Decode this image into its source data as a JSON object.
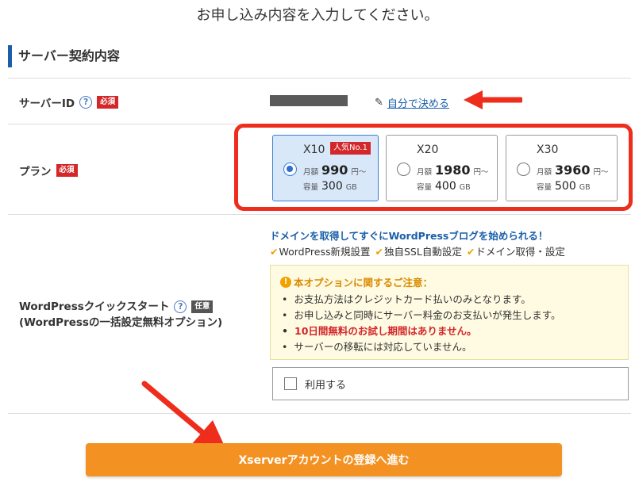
{
  "page": {
    "heading": "お申し込み内容を入力してください。"
  },
  "section": {
    "title": "サーバー契約内容"
  },
  "server_id": {
    "label": "サーバーID",
    "help_icon": "?",
    "required_badge": "必須",
    "self_link_label": "自分で決める"
  },
  "plan": {
    "label": "プラン",
    "required_badge": "必須",
    "options": [
      {
        "name": "X10",
        "popular_badge": "人気No.1",
        "price_label": "月額",
        "price": "990",
        "price_unit": "円〜",
        "storage_label": "容量",
        "storage": "300",
        "storage_unit": "GB",
        "selected": true
      },
      {
        "name": "X20",
        "popular_badge": "",
        "price_label": "月額",
        "price": "1980",
        "price_unit": "円〜",
        "storage_label": "容量",
        "storage": "400",
        "storage_unit": "GB",
        "selected": false
      },
      {
        "name": "X30",
        "popular_badge": "",
        "price_label": "月額",
        "price": "3960",
        "price_unit": "円〜",
        "storage_label": "容量",
        "storage": "500",
        "storage_unit": "GB",
        "selected": false
      }
    ]
  },
  "wp_quickstart": {
    "label_line1": "WordPressクイックスタート",
    "label_line2": "(WordPressの一括設定無料オプション)",
    "help_icon": "?",
    "optional_badge": "任意",
    "promo": "ドメインを取得してすぐにWordPressブログを始められる！",
    "features": [
      "WordPress新規設置",
      "独自SSL自動設定",
      "ドメイン取得・設定"
    ],
    "feature_check": "✔",
    "notice": {
      "title": "本オプションに関するご注意：",
      "icon": "!",
      "items": [
        "お支払方法はクレジットカード払いのみとなります。",
        "お申し込みと同時にサーバー料金のお支払いが発生します。",
        "10日間無料のお試し期間はありません。",
        "サーバーの移転には対応していません。"
      ]
    },
    "use_checkbox_label": "利用する",
    "use_checked": false
  },
  "cta": {
    "label": "Xserverアカウントの登録へ進む"
  },
  "colors": {
    "accent_blue": "#1a5fa8",
    "required_red": "#d3272a",
    "highlight_red": "#ee2d1d",
    "cta_orange": "#f39222",
    "notice_bg": "#fffbe3",
    "selected_plan_bg": "#d8e8f9"
  }
}
